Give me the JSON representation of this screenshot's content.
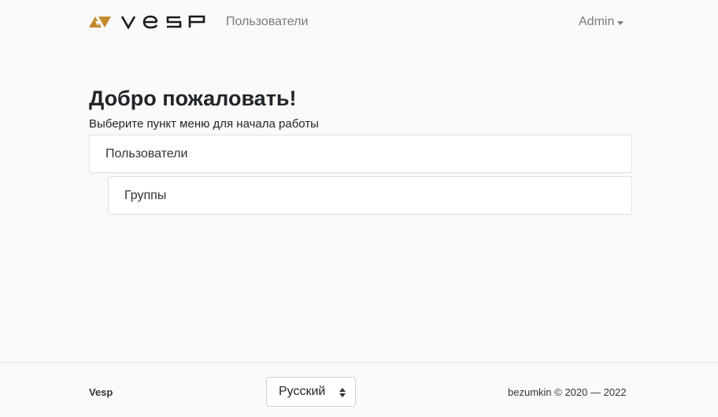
{
  "navbar": {
    "brand": "vesp",
    "nav_link": "Пользователи",
    "user_menu": "Admin"
  },
  "main": {
    "title": "Добро пожаловать!",
    "subtitle": "Выберите пункт меню для начала работы",
    "menu_items": [
      {
        "label": "Пользователи"
      },
      {
        "label": "Группы"
      }
    ]
  },
  "footer": {
    "brand": "Vesp",
    "language": "Русский",
    "copyright": "bezumkin © 2020 — 2022"
  },
  "colors": {
    "logo_accent": "#c48a2c",
    "logo_text": "#1a1a1a",
    "background": "#fafafa"
  }
}
